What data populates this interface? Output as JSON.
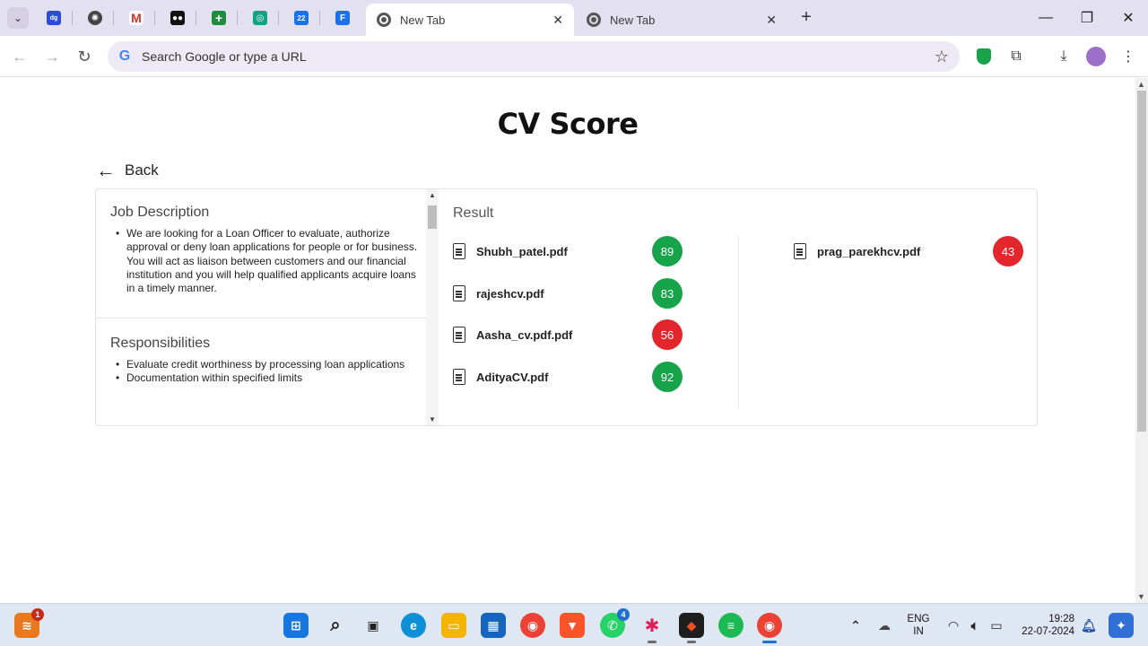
{
  "browser": {
    "pinned_tabs": [
      {
        "icon": "digio-icon",
        "color": "#2b4bd9"
      },
      {
        "icon": "chatgpt-icon",
        "color": "#444444"
      },
      {
        "icon": "gmail-icon",
        "color": "#d93025"
      },
      {
        "icon": "medium-icon",
        "color": "#111111"
      },
      {
        "icon": "sheets-plus-icon",
        "color": "#1e8e3e"
      },
      {
        "icon": "app-icon",
        "color": "#10a37f"
      },
      {
        "icon": "calendar-icon",
        "color": "#1a73e8"
      },
      {
        "icon": "forms-icon",
        "color": "#1a73e8"
      }
    ],
    "tabs": [
      {
        "title": "New Tab",
        "active": true
      },
      {
        "title": "New Tab",
        "active": false
      }
    ],
    "omnibox_placeholder": "Search Google or type a URL"
  },
  "page": {
    "title": "CV Score",
    "back_label": "Back",
    "job_description_heading": "Job Description",
    "job_description_items": [
      "We are looking for a Loan Officer to evaluate, authorize approval or deny loan applications for people or for business. You will act as liaison between customers and our financial institution and you will help qualified applicants acquire loans in a timely manner."
    ],
    "responsibilities_heading": "Responsibilities",
    "responsibilities_items": [
      "Evaluate credit worthiness by processing loan applications",
      "Documentation within specified limits"
    ],
    "result_heading": "Result",
    "results": [
      {
        "file": "Shubh_patel.pdf",
        "score": "89",
        "status": "pass"
      },
      {
        "file": "rajeshcv.pdf",
        "score": "83",
        "status": "pass"
      },
      {
        "file": "Aasha_cv.pdf.pdf",
        "score": "56",
        "status": "fail"
      },
      {
        "file": "AdityaCV.pdf",
        "score": "92",
        "status": "pass"
      },
      {
        "file": "prag_parekhcv.pdf",
        "score": "43",
        "status": "fail"
      }
    ],
    "colors": {
      "pass": "#16a34a",
      "fail": "#e3262b"
    }
  },
  "taskbar": {
    "notification_badge": "1",
    "whatsapp_badge": "4",
    "language": "ENG",
    "region": "IN",
    "time": "19:28",
    "date": "22-07-2024"
  }
}
